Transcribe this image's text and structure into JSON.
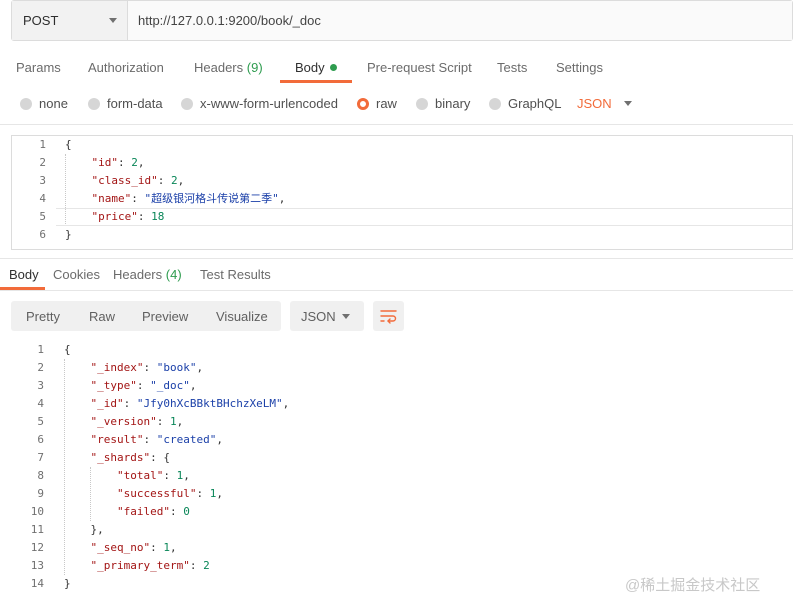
{
  "request": {
    "method": "POST",
    "url": "http://127.0.0.1:9200/book/_doc"
  },
  "request_tabs": [
    {
      "label": "Params"
    },
    {
      "label": "Authorization"
    },
    {
      "label": "Headers",
      "count": "(9)"
    },
    {
      "label": "Body"
    },
    {
      "label": "Pre-request Script"
    },
    {
      "label": "Tests"
    },
    {
      "label": "Settings"
    }
  ],
  "body_types": [
    "none",
    "form-data",
    "x-www-form-urlencoded",
    "raw",
    "binary",
    "GraphQL"
  ],
  "body_format": "JSON",
  "request_body": {
    "line_numbers": [
      "1",
      "2",
      "3",
      "4",
      "5",
      "6"
    ],
    "l1": "{",
    "l2_key": "\"id\"",
    "l2_val": "2",
    "l3_key": "\"class_id\"",
    "l3_val": "2",
    "l4_key": "\"name\"",
    "l4_val": "\"超级银河格斗传说第二季\"",
    "l5_key": "\"price\"",
    "l5_val": "18",
    "l6": "}"
  },
  "response_tabs": [
    {
      "label": "Body"
    },
    {
      "label": "Cookies"
    },
    {
      "label": "Headers",
      "count": "(4)"
    },
    {
      "label": "Test Results"
    }
  ],
  "response_views": [
    "Pretty",
    "Raw",
    "Preview",
    "Visualize"
  ],
  "response_format": "JSON",
  "response_body": {
    "line_numbers": [
      "1",
      "2",
      "3",
      "4",
      "5",
      "6",
      "7",
      "8",
      "9",
      "10",
      "11",
      "12",
      "13",
      "14"
    ],
    "l1": "{",
    "l2_key": "\"_index\"",
    "l2_val": "\"book\"",
    "l3_key": "\"_type\"",
    "l3_val": "\"_doc\"",
    "l4_key": "\"_id\"",
    "l4_val": "\"Jfy0hXcBBktBHchzXeLM\"",
    "l5_key": "\"_version\"",
    "l5_val": "1",
    "l6_key": "\"result\"",
    "l6_val": "\"created\"",
    "l7_key": "\"_shards\"",
    "l7_val": "{",
    "l8_key": "\"total\"",
    "l8_val": "1",
    "l9_key": "\"successful\"",
    "l9_val": "1",
    "l10_key": "\"failed\"",
    "l10_val": "0",
    "l11": "},",
    "l12_key": "\"_seq_no\"",
    "l12_val": "1",
    "l13_key": "\"_primary_term\"",
    "l13_val": "2",
    "l14": "}"
  },
  "watermark": "@稀土掘金技术社区",
  "colors": {
    "accent": "#f26b3a",
    "count_green": "#2e9c4f",
    "json_key": "#a31515",
    "json_string": "#1a3fa8",
    "json_number": "#098658"
  }
}
